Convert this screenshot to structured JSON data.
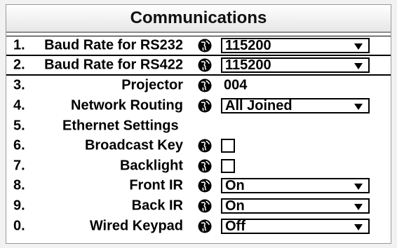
{
  "window": {
    "title": "Communications"
  },
  "rows": [
    {
      "num": "1.",
      "label": "Baud Rate for RS232",
      "type": "select",
      "value": "115200"
    },
    {
      "num": "2.",
      "label": "Baud Rate for RS422",
      "type": "select",
      "value": "115200"
    },
    {
      "num": "3.",
      "label": "Projector",
      "type": "text",
      "value": "004"
    },
    {
      "num": "4.",
      "label": "Network Routing",
      "type": "select",
      "value": "All Joined"
    },
    {
      "num": "5.",
      "label": "Ethernet Settings",
      "type": "submenu"
    },
    {
      "num": "6.",
      "label": "Broadcast Key",
      "type": "checkbox",
      "checked": false
    },
    {
      "num": "7.",
      "label": "Backlight",
      "type": "checkbox",
      "checked": false
    },
    {
      "num": "8.",
      "label": "Front IR",
      "type": "select",
      "value": "On"
    },
    {
      "num": "9.",
      "label": "Back IR",
      "type": "select",
      "value": "On"
    },
    {
      "num": "0.",
      "label": "Wired Keypad",
      "type": "select",
      "value": "Off"
    }
  ],
  "icons": {
    "row_icon": "globe-icon",
    "dropdown": "triangle-down-icon"
  }
}
